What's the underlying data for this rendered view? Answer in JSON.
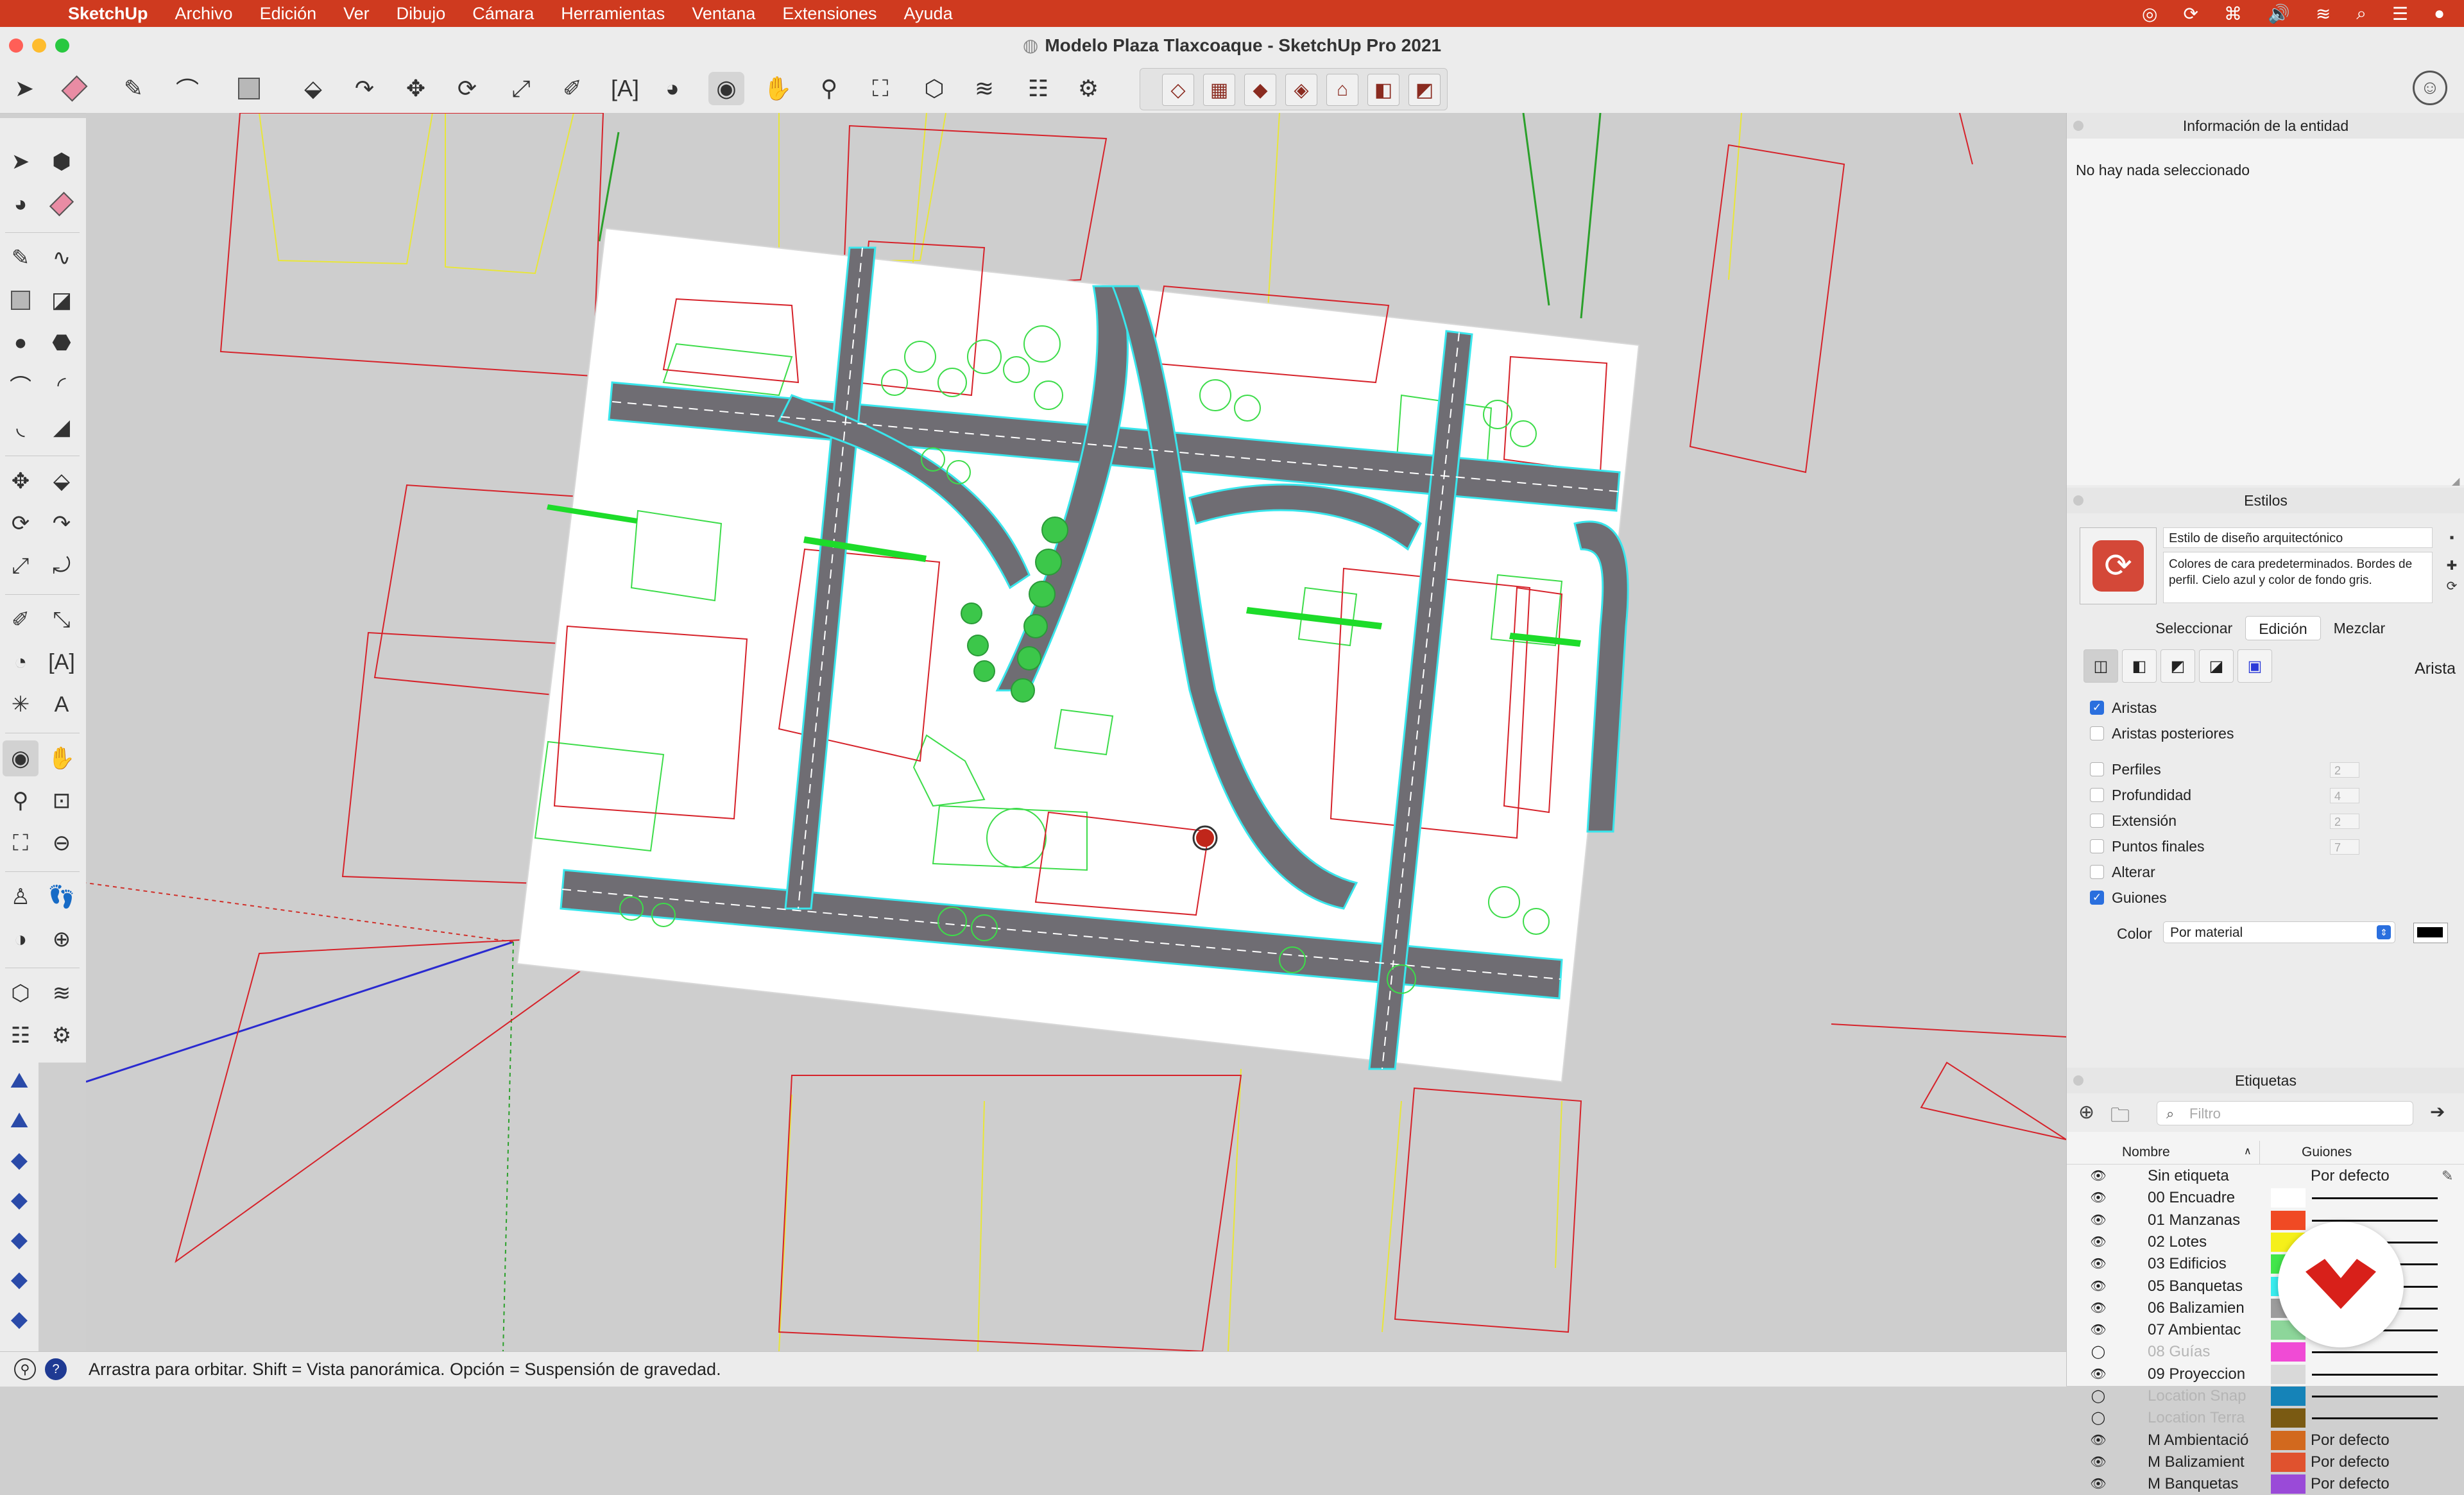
{
  "menubar": {
    "app": "SketchUp",
    "items": [
      "Archivo",
      "Edición",
      "Ver",
      "Dibujo",
      "Cámara",
      "Herramientas",
      "Ventana",
      "Extensiones",
      "Ayuda"
    ]
  },
  "window": {
    "title": "Modelo Plaza Tlaxcoaque  - SketchUp Pro 2021"
  },
  "toolbar": {
    "tools": [
      "select-icon",
      "eraser-icon",
      "pencil-icon",
      "arc-icon",
      "rectangle-icon",
      "push-pull-icon",
      "follow-me-icon",
      "move-icon",
      "rotate-icon",
      "scale-icon",
      "tape-measure-icon",
      "text-icon",
      "paint-bucket-icon",
      "orbit-icon",
      "pan-icon",
      "zoom-icon",
      "zoom-extents-icon",
      "3d-warehouse-icon",
      "extension-warehouse-icon",
      "layout-icon",
      "extension-manager-icon"
    ],
    "active_tool": "orbit-icon",
    "views": [
      "iso-view-icon",
      "top-view-icon",
      "front-view-icon",
      "right-view-icon",
      "back-view-icon",
      "left-view-icon",
      "bottom-view-icon",
      "perspective-icon"
    ]
  },
  "statusbar": {
    "text": "Arrastra para orbitar. Shift = Vista panorámica. Opción = Suspensión de gravedad."
  },
  "entity_panel": {
    "title": "Información de la entidad",
    "message": "No hay nada seleccionado"
  },
  "styles_panel": {
    "title": "Estilos",
    "style_name": "Estilo de diseño arquitectónico",
    "style_description": "Colores de cara predeterminados. Bordes de perfil. Cielo azul y color de fondo gris.",
    "tabs": [
      "Seleccionar",
      "Edición",
      "Mezclar"
    ],
    "selected_tab": "Edición",
    "section_title": "Arista",
    "options": [
      {
        "label": "Aristas",
        "checked": true,
        "value": ""
      },
      {
        "label": "Aristas posteriores",
        "checked": false,
        "value": ""
      },
      {
        "label": "Perfiles",
        "checked": false,
        "value": "2"
      },
      {
        "label": "Profundidad",
        "checked": false,
        "value": "4"
      },
      {
        "label": "Extensión",
        "checked": false,
        "value": "2"
      },
      {
        "label": "Puntos finales",
        "checked": false,
        "value": "7"
      },
      {
        "label": "Alterar",
        "checked": false,
        "value": ""
      },
      {
        "label": "Guiones",
        "checked": true,
        "value": ""
      }
    ],
    "color_label": "Color",
    "color_value": "Por material",
    "color_swatch": "#000000"
  },
  "tags_panel": {
    "title": "Etiquetas",
    "filter_placeholder": "Filtro",
    "col_name": "Nombre",
    "col_dashes": "Guiones",
    "rows": [
      {
        "name": "Sin etiqueta",
        "visible": true,
        "color": "",
        "dash": "Por defecto"
      },
      {
        "name": "00 Encuadre",
        "visible": true,
        "color": "#ffffff",
        "dash": ""
      },
      {
        "name": "01 Manzanas",
        "visible": true,
        "color": "#f04a24",
        "dash": ""
      },
      {
        "name": "02 Lotes",
        "visible": true,
        "color": "#f5f01a",
        "dash": ""
      },
      {
        "name": "03 Edificios",
        "visible": true,
        "color": "#42e64a",
        "dash": ""
      },
      {
        "name": "05 Banquetas",
        "visible": true,
        "color": "#39eef0",
        "dash": ""
      },
      {
        "name": "06 Balizamien",
        "visible": true,
        "color": "#9c9c9c",
        "dash": ""
      },
      {
        "name": "07 Ambientac",
        "visible": true,
        "color": "#8dd69a",
        "dash": ""
      },
      {
        "name": "08 Guías",
        "visible": false,
        "color": "#f04bd5",
        "dash": ""
      },
      {
        "name": "09 Proyeccion",
        "visible": true,
        "color": "#d9d9d9",
        "dash": ""
      },
      {
        "name": "Location Snap",
        "visible": false,
        "color": "#1583b8",
        "dash": ""
      },
      {
        "name": "Location Terra",
        "visible": false,
        "color": "#7a5a12",
        "dash": ""
      },
      {
        "name": "M Ambientació",
        "visible": true,
        "color": "#d2691e",
        "dash": "Por defecto"
      },
      {
        "name": "M Balizamient",
        "visible": true,
        "color": "#e0522e",
        "dash": "Por defecto"
      },
      {
        "name": "M Banquetas",
        "visible": true,
        "color": "#9a4ad8",
        "dash": "Por defecto"
      }
    ]
  }
}
